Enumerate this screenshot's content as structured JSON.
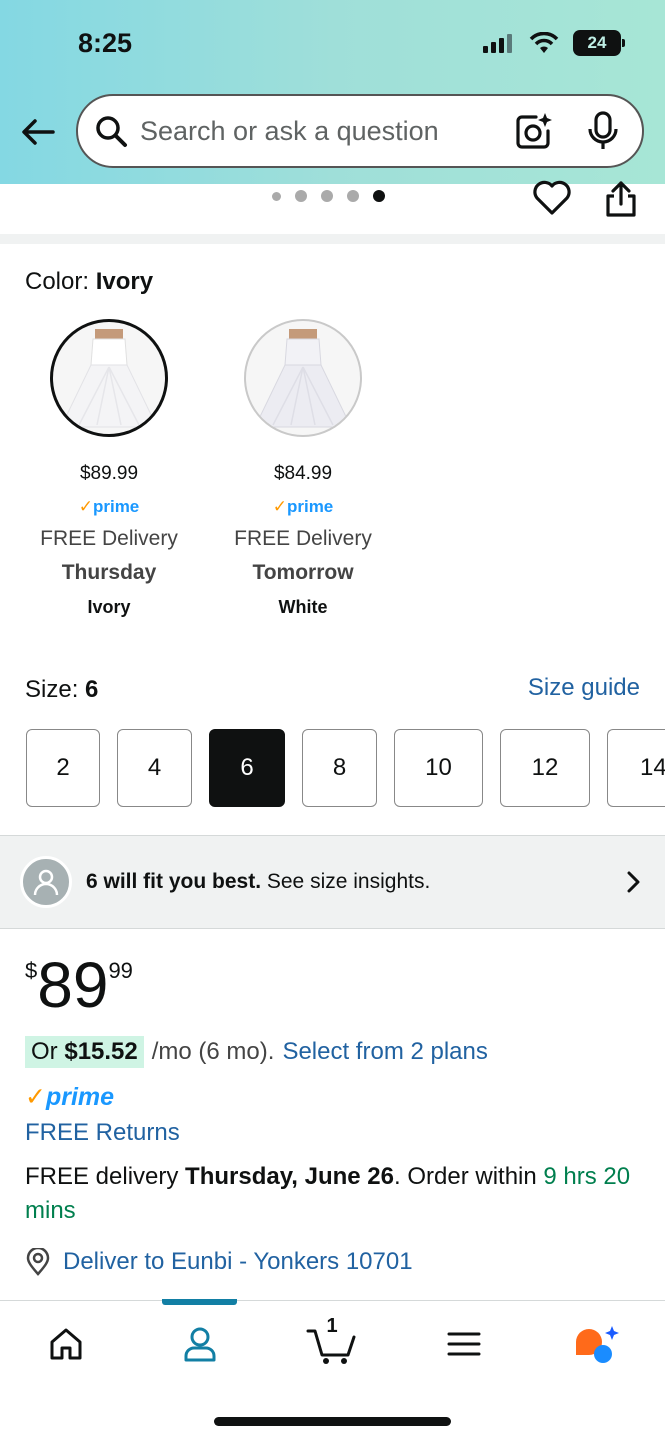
{
  "status_bar": {
    "time": "8:25",
    "battery": "24"
  },
  "search": {
    "placeholder": "Search or ask a question"
  },
  "carousel": {
    "dot_count": 5,
    "active_index": 4
  },
  "color": {
    "label": "Color:",
    "selected": "Ivory"
  },
  "swatches": [
    {
      "price": "$89.99",
      "prime": "prime",
      "delivery": "FREE Delivery",
      "day": "Thursday",
      "name": "Ivory"
    },
    {
      "price": "$84.99",
      "prime": "prime",
      "delivery": "FREE Delivery",
      "day": "Tomorrow",
      "name": "White"
    }
  ],
  "size": {
    "label": "Size:",
    "selected": "6",
    "guide": "Size guide",
    "options": [
      "2",
      "4",
      "6",
      "8",
      "10",
      "12",
      "14"
    ]
  },
  "fit": {
    "bold": "6 will fit you best.",
    "rest": "See size insights."
  },
  "price": {
    "symbol": "$",
    "whole": "89",
    "fraction": "99"
  },
  "monthly": {
    "prefix": "Or",
    "amount": "$15.52",
    "rest": "/mo (6 mo).",
    "plans": "Select from 2 plans"
  },
  "prime": {
    "label": "prime"
  },
  "returns": "FREE Returns",
  "delivery": {
    "prefix": "FREE delivery",
    "date": "Thursday, June 26",
    "mid": ". Order within",
    "countdown": "9 hrs 20 mins"
  },
  "deliver_to": "Deliver to Eunbi - Yonkers 10701",
  "bottom_nav": {
    "cart_count": "1",
    "active": "account"
  },
  "colors": {
    "link": "#2162a1",
    "prime": "#1a98ff",
    "accent_orange": "#ff9900",
    "countdown_green": "#007f4e"
  }
}
